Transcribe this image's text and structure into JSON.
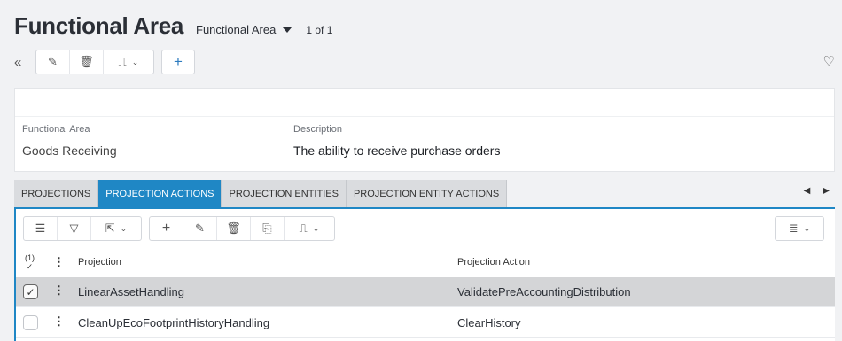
{
  "header": {
    "title": "Functional Area",
    "selector_label": "Functional Area",
    "record_count": "1 of 1"
  },
  "toolbar": {
    "icons": [
      "double-chevron-left-icon",
      "pencil-icon",
      "trash-icon",
      "stamp-icon",
      "plus-icon",
      "heart-icon"
    ]
  },
  "record": {
    "fields": [
      {
        "label": "Functional Area",
        "value": "Goods Receiving"
      },
      {
        "label": "Description",
        "value": "The ability to receive purchase orders"
      }
    ]
  },
  "tabs": [
    {
      "label": "PROJECTIONS",
      "active": false
    },
    {
      "label": "PROJECTION ACTIONS",
      "active": true
    },
    {
      "label": "PROJECTION ENTITIES",
      "active": false
    },
    {
      "label": "PROJECTION ENTITY ACTIONS",
      "active": false
    }
  ],
  "grid": {
    "selection_count": "(1)",
    "columns": [
      "Projection",
      "Projection Action"
    ],
    "rows": [
      {
        "projection": "LinearAssetHandling",
        "action": "ValidatePreAccountingDistribution",
        "selected": true
      },
      {
        "projection": "CleanUpEcoFootprintHistoryHandling",
        "action": "ClearHistory",
        "selected": false
      }
    ]
  },
  "colors": {
    "accent": "#1f87c5",
    "selected_row": "#d4d5d7",
    "tab_inactive": "#dadcdf"
  }
}
